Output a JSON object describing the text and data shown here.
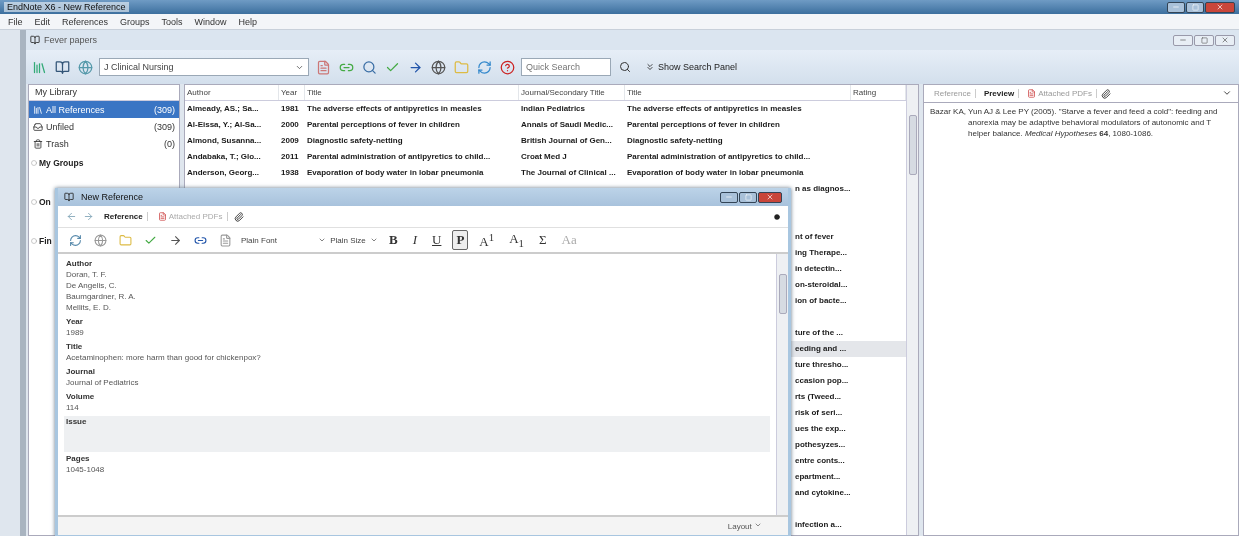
{
  "app_title": "EndNote X6 - New Reference",
  "menu": [
    "File",
    "Edit",
    "References",
    "Groups",
    "Tools",
    "Window",
    "Help"
  ],
  "library": {
    "title": "Fever papers",
    "toolbar": {
      "style": "J Clinical Nursing",
      "search_placeholder": "Quick Search",
      "search_panel": "Show Search Panel"
    },
    "sidebar": {
      "header": "My Library",
      "items": [
        {
          "label": "All References",
          "count": "(309)",
          "selected": true
        },
        {
          "label": "Unfiled",
          "count": "(309)",
          "selected": false
        },
        {
          "label": "Trash",
          "count": "(0)",
          "selected": false
        }
      ],
      "groups": [
        {
          "label": "My Groups"
        },
        {
          "label": "On"
        },
        {
          "label": "Fin"
        }
      ]
    },
    "table": {
      "columns": [
        "Author",
        "Year",
        "Title",
        "Journal/Secondary Title",
        "Title",
        "Rating"
      ],
      "rows": [
        {
          "author": "Almeady, AS.; Sa...",
          "year": "1981",
          "title": "The adverse effects of antipyretics in measles",
          "journal": "Indian Pediatrics",
          "title_2": "The adverse effects of antipyretics in measles"
        },
        {
          "author": "Al-Eissa, Y.; Al-Sa...",
          "year": "2000",
          "title": "Parental perceptions of fever in children",
          "journal": "Annals of Saudi Medic...",
          "title_2": "Parental perceptions of fever in children"
        },
        {
          "author": "Almond, Susanna...",
          "year": "2009",
          "title": "Diagnostic safety-netting",
          "journal": "British Journal of Gen...",
          "title_2": "Diagnostic safety-netting"
        },
        {
          "author": "Andabaka, T.; Glo...",
          "year": "2011",
          "title": "Parental administration of antipyretics to child...",
          "journal": "Croat Med J",
          "title_2": "Parental administration of antipyretics to child..."
        },
        {
          "author": "Anderson, Georg...",
          "year": "1938",
          "title": "Evaporation of body water in lobar pneumonia",
          "journal": "The Journal of Clinical ...",
          "title_2": "Evaporation of body water in lobar pneumonia"
        }
      ],
      "covered_rows": [
        {
          "fragment": "n as diagnos...",
          "selected": false
        },
        {
          "selected": false
        },
        {
          "selected": false
        },
        {
          "fragment": "nt of fever",
          "selected": false
        },
        {
          "fragment": "ing Therape...",
          "selected": false
        },
        {
          "fragment": "in detectin...",
          "selected": false
        },
        {
          "fragment": "on-steroidal...",
          "selected": false
        },
        {
          "fragment": "ion of bacte...",
          "selected": false
        },
        {
          "selected": false
        },
        {
          "fragment": "ture of the ...",
          "selected": false
        },
        {
          "fragment": "eeding and ...",
          "selected": true
        },
        {
          "fragment": "ture thresho...",
          "selected": false
        },
        {
          "fragment": "ccasion pop...",
          "selected": false
        },
        {
          "fragment": "rts (Tweed...",
          "selected": false
        },
        {
          "fragment": "risk of seri...",
          "selected": false
        },
        {
          "fragment": "ues the exp...",
          "selected": false
        },
        {
          "fragment": "pothesyzes...",
          "selected": false
        },
        {
          "fragment": "entre conts...",
          "selected": false
        },
        {
          "fragment": "epartment...",
          "selected": false
        },
        {
          "fragment": "and cytokine...",
          "selected": false
        },
        {
          "selected": false
        },
        {
          "fragment": "infection a...",
          "selected": false
        }
      ]
    },
    "preview": {
      "tabs": [
        {
          "label": "Reference",
          "selected": false
        },
        {
          "label": "Preview",
          "selected": true
        },
        {
          "label": "Attached PDFs",
          "selected": false
        }
      ],
      "text": "Bazar KA, Yun AJ & Lee PY (2005). \"Starve a fever and feed a cold\": feeding and anorexia may be adaptive behavioral modulators of autonomic and T helper balance. *Medical Hypotheses* **64**, 1080-1086."
    }
  },
  "dialog": {
    "title": "New Reference",
    "tabs": [
      {
        "label": "Reference",
        "selected": true
      },
      {
        "label": "Attached PDFs",
        "selected": false
      }
    ],
    "font": "Plain Font",
    "size": "Plain Size",
    "format_buttons": [
      {
        "label": "B",
        "kind": "bold",
        "selected": false
      },
      {
        "label": "I",
        "kind": "italic",
        "selected": false
      },
      {
        "label": "U",
        "kind": "underline",
        "selected": false
      },
      {
        "label": "P",
        "kind": "plain",
        "selected": true
      },
      {
        "label": "A$^{1}$",
        "kind": "superscript",
        "selected": false
      },
      {
        "label": "A$_{1}$",
        "kind": "subscript",
        "selected": false
      },
      {
        "label": "Σ",
        "kind": "symbol",
        "selected": false
      },
      {
        "label": "Aa",
        "kind": "case",
        "selected": false
      }
    ],
    "fields": [
      {
        "label": "Author",
        "lines": [
          "Doran, T. F.",
          "De Angelis, C.",
          "Baumgardner, R. A.",
          "Mellits, E. D."
        ],
        "selected": false
      },
      {
        "label": "Year",
        "lines": [
          "1989"
        ],
        "selected": false
      },
      {
        "label": "Title",
        "lines": [
          "Acetaminophen: more harm than good for chickenpox?"
        ],
        "selected": false
      },
      {
        "label": "Journal",
        "lines": [
          "Journal of Pediatrics"
        ],
        "selected": false
      },
      {
        "label": "Volume",
        "lines": [
          "114"
        ],
        "selected": false
      },
      {
        "label": "Issue",
        "selected": true
      },
      {
        "label": "Pages",
        "lines": [
          "1045-1048"
        ],
        "selected": false
      }
    ],
    "layout_button": "Layout"
  }
}
